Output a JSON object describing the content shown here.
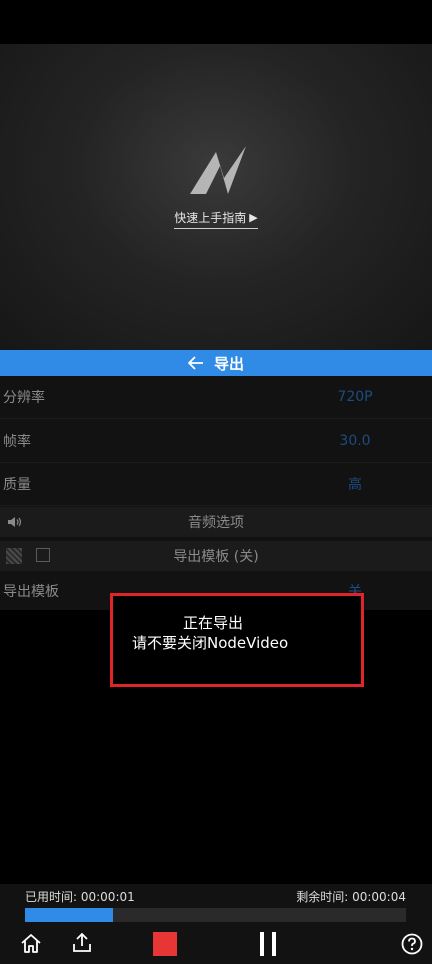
{
  "preview": {
    "guide_link": "快速上手指南",
    "logo_icon": "nodevideo-logo-icon",
    "play_icon": "play-triangle-icon"
  },
  "export_header": {
    "title": "导出",
    "back_icon": "back-arrow-icon"
  },
  "settings": {
    "resolution": {
      "label": "分辨率",
      "value": "720P"
    },
    "frame_rate": {
      "label": "帧率",
      "value": "30.0"
    },
    "quality": {
      "label": "质量",
      "value": "高"
    },
    "audio_options": {
      "label": "音频选项",
      "icon": "speaker-icon"
    },
    "export_template_section": {
      "label": "导出模板 (关)",
      "checked": false
    },
    "export_template_row": {
      "label": "导出模板",
      "value": "关"
    }
  },
  "overlay": {
    "line1": "正在导出",
    "line2": "请不要关闭NodeVideo",
    "border_color": "#e2232a"
  },
  "progress": {
    "elapsed": "已用时间: 00:00:01",
    "remaining": "剩余时间: 00:00:04",
    "fraction": 0.23
  },
  "controls": {
    "home_icon": "home-icon",
    "share_icon": "share-icon",
    "stop_icon": "stop-icon",
    "pause_icon": "pause-icon",
    "help_icon": "help-icon"
  },
  "colors": {
    "accent": "#2f8be6",
    "stop": "#e83535",
    "setting_value": "#1c4c80"
  }
}
